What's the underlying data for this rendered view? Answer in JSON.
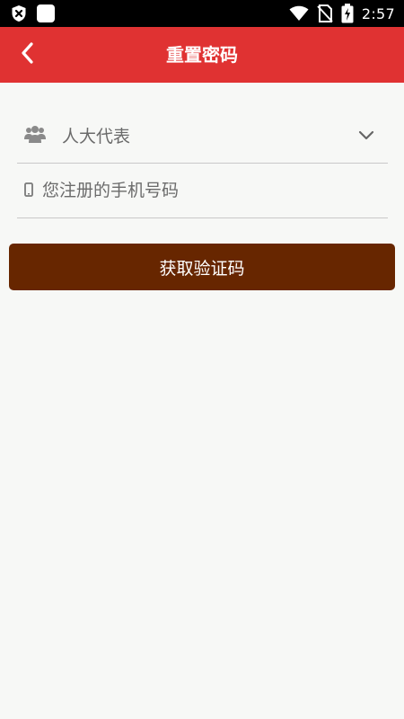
{
  "status_bar": {
    "time": "2:57",
    "icons": [
      "shield-x-icon",
      "notification-square-icon",
      "wifi-icon",
      "no-sim-icon",
      "battery-charging-icon"
    ]
  },
  "header": {
    "title": "重置密码",
    "back_icon": "chevron-left-icon"
  },
  "form": {
    "role_select": {
      "value": "人大代表",
      "icon": "users-group-icon",
      "dropdown_icon": "chevron-down-icon"
    },
    "phone_input": {
      "placeholder": "您注册的手机号码",
      "value": "",
      "icon": "mobile-phone-icon"
    },
    "submit_label": "获取验证码"
  },
  "colors": {
    "status_bar": "#000000",
    "header": "#e03232",
    "page_background": "#f7f8f6",
    "button": "#672600",
    "divider": "#c9c9c9",
    "muted_text": "#6b6b6b"
  }
}
